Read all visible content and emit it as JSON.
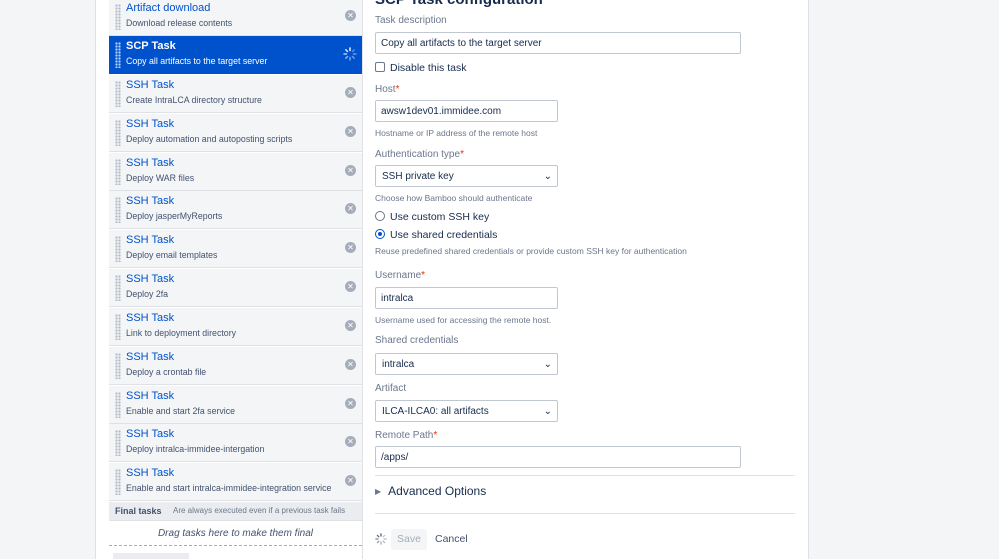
{
  "tasks": [
    {
      "title": "Artifact download",
      "desc": "Download release contents"
    },
    {
      "title": "SCP Task",
      "desc": "Copy all artifacts to the target server"
    },
    {
      "title": "SSH Task",
      "desc": "Create IntraLCA directory structure"
    },
    {
      "title": "SSH Task",
      "desc": "Deploy automation and autoposting scripts"
    },
    {
      "title": "SSH Task",
      "desc": "Deploy WAR files"
    },
    {
      "title": "SSH Task",
      "desc": "Deploy jasperMyReports"
    },
    {
      "title": "SSH Task",
      "desc": "Deploy email templates"
    },
    {
      "title": "SSH Task",
      "desc": "Deploy 2fa"
    },
    {
      "title": "SSH Task",
      "desc": "Link to deployment directory"
    },
    {
      "title": "SSH Task",
      "desc": "Deploy a crontab file"
    },
    {
      "title": "SSH Task",
      "desc": "Enable and start 2fa service"
    },
    {
      "title": "SSH Task",
      "desc": "Deploy intralca-immidee-intergation"
    },
    {
      "title": "SSH Task",
      "desc": "Enable and start intralca-immidee-integration service"
    }
  ],
  "final": {
    "title": "Final tasks",
    "hint": "Are always executed even if a previous task fails",
    "drop_hint": "Drag tasks here to make them final"
  },
  "config": {
    "title": "SCP Task configuration",
    "task_description_label": "Task description",
    "task_description_value": "Copy all artifacts to the target server",
    "disable_label": "Disable this task",
    "host_label": "Host",
    "host_value": "awsw1dev01.immidee.com",
    "host_help": "Hostname or IP address of the remote host",
    "auth_label": "Authentication type",
    "auth_value": "SSH private key",
    "auth_help": "Choose how Bamboo should authenticate",
    "radio_custom": "Use custom SSH key",
    "radio_shared": "Use shared credentials",
    "radio_help": "Reuse predefined shared credentials or provide custom SSH key for authentication",
    "username_label": "Username",
    "username_value": "intralca",
    "username_help": "Username used for accessing the remote host.",
    "shared_label": "Shared credentials",
    "shared_value": "intralca",
    "artifact_label": "Artifact",
    "artifact_value": "ILCA-ILCA0: all artifacts",
    "remote_label": "Remote Path",
    "remote_value": "/apps/",
    "advanced_label": "Advanced Options",
    "save_label": "Save",
    "cancel_label": "Cancel",
    "required_mark": "*"
  },
  "colors": {
    "accent": "#0052cc",
    "required": "#de350b"
  },
  "icons": {
    "delete": "x-circle-icon",
    "loading": "spinner-icon",
    "drag": "drag-handle-icon",
    "select": "chevron-down-icon",
    "expand": "chevron-right-icon"
  }
}
